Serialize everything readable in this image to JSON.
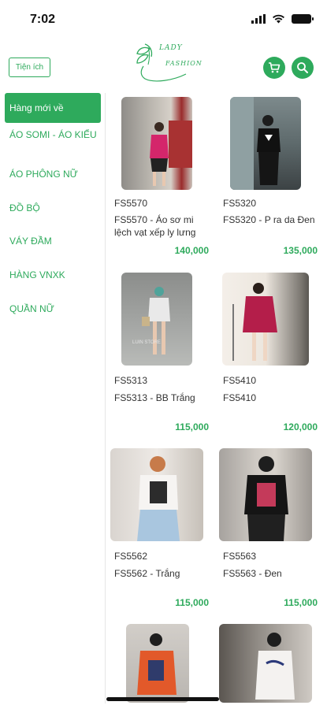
{
  "status": {
    "time": "7:02"
  },
  "header": {
    "utility_label": "Tiện ích",
    "logo_line1": "LADY",
    "logo_line2": "FASHION",
    "cart_icon": "cart-icon",
    "search_icon": "search-icon"
  },
  "colors": {
    "accent": "#2eaa5c"
  },
  "sidebar": {
    "items": [
      {
        "label": "Hàng mới về",
        "active": true
      },
      {
        "label": "ÁO SOMI - ÁO KIỂU"
      },
      {
        "label": "ÁO PHÔNG NỮ"
      },
      {
        "label": "ĐỒ BỘ"
      },
      {
        "label": "VÁY ĐẦM"
      },
      {
        "label": "HÀNG VNXK"
      },
      {
        "label": "QUẦN NỮ"
      }
    ]
  },
  "products": [
    {
      "code": "FS5570",
      "name": "FS5570 - Áo sơ mi lệch vạt xếp ly lưng",
      "price": "140,000"
    },
    {
      "code": "FS5320",
      "name": "FS5320 - P ra da Đen",
      "price": "135,000"
    },
    {
      "code": "FS5313",
      "name": "FS5313 - BB Trắng",
      "price": "115,000"
    },
    {
      "code": "FS5410",
      "name": "FS5410",
      "price": "120,000"
    },
    {
      "code": "FS5562",
      "name": "FS5562 - Trắng",
      "price": "115,000"
    },
    {
      "code": "FS5563",
      "name": "FS5563 - Đen",
      "price": "115,000"
    },
    {
      "code": "",
      "name": "",
      "price": ""
    },
    {
      "code": "",
      "name": "",
      "price": ""
    }
  ]
}
